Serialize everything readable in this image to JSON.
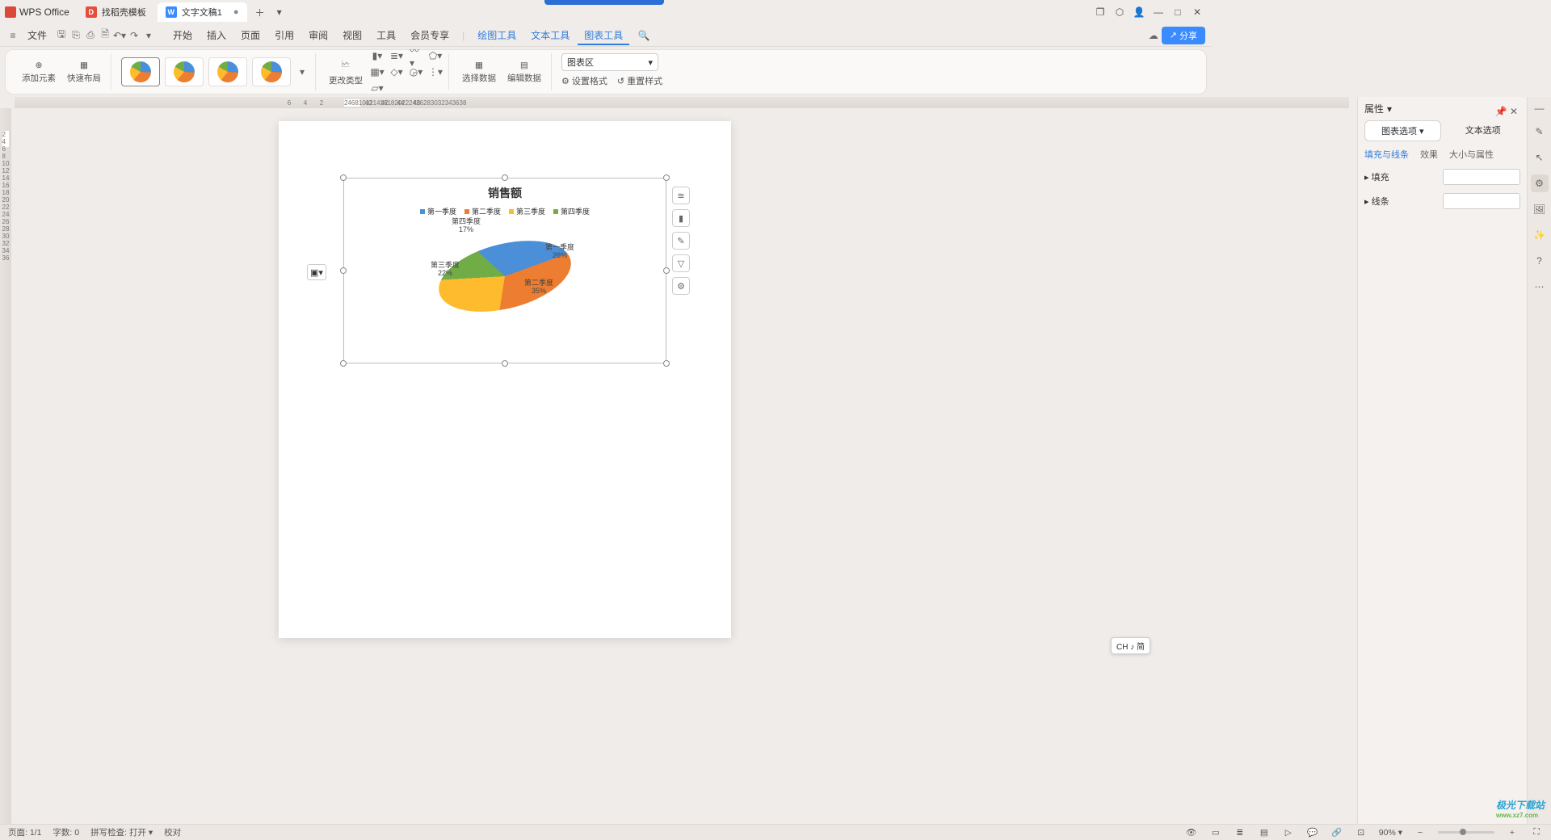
{
  "app": {
    "name": "WPS Office"
  },
  "tabs": [
    {
      "label": "找稻壳模板",
      "iconBg": "#e74c3c",
      "iconTxt": "D"
    },
    {
      "label": "文字文稿1",
      "iconBg": "#3a8bff",
      "iconTxt": "W",
      "active": true
    }
  ],
  "window_buttons": {
    "multiwin": "❐",
    "cube": "⬡",
    "user": "👤",
    "min": "—",
    "max": "□",
    "close": "✕"
  },
  "menubar": {
    "file": "文件",
    "items": [
      "开始",
      "插入",
      "页面",
      "引用",
      "审阅",
      "视图",
      "工具",
      "会员专享"
    ],
    "extra": [
      "绘图工具",
      "文本工具",
      "图表工具"
    ],
    "share": "分享"
  },
  "ribbon": {
    "addElement": "添加元素",
    "quickLayout": "快速布局",
    "changeType": "更改类型",
    "selectData": "选择数据",
    "editData": "编辑数据",
    "chartAreaSel": "图表区",
    "setFormat": "设置格式",
    "resetStyle": "重置样式"
  },
  "chart_data": {
    "type": "pie",
    "title": "销售额",
    "categories": [
      "第一季度",
      "第二季度",
      "第三季度",
      "第四季度"
    ],
    "values": [
      26,
      35,
      22,
      17
    ],
    "series": [
      {
        "name": "销售额",
        "values": [
          26,
          35,
          22,
          17
        ]
      }
    ],
    "labels": [
      {
        "name": "第一季度",
        "pct": "26%"
      },
      {
        "name": "第二季度",
        "pct": "35%"
      },
      {
        "name": "第三季度",
        "pct": "22%"
      },
      {
        "name": "第四季度",
        "pct": "17%"
      }
    ],
    "colors": [
      "#4a8fd8",
      "#ed7d31",
      "#fdbb2d",
      "#70ad47"
    ]
  },
  "rightpane": {
    "title": "属性",
    "tab_chart": "图表选项",
    "tab_text": "文本选项",
    "sub_fill": "填充与线条",
    "sub_effect": "效果",
    "sub_size": "大小与属性",
    "row_fill": "填充",
    "row_line": "线条",
    "pin": "📌",
    "close": "✕",
    "collapse": "—"
  },
  "ime": "CH ♪ 简",
  "hruler_left": [
    "6",
    "4",
    "2"
  ],
  "hruler_doc": [
    "2",
    "4",
    "6",
    "8",
    "10",
    "12",
    "14",
    "16",
    "18",
    "20",
    "22",
    "24",
    "26",
    "28",
    "30",
    "32",
    "34",
    "36",
    "38",
    "40",
    "42",
    "44",
    "46"
  ],
  "vruler_doc": [
    "2",
    "4",
    "6",
    "8",
    "10",
    "12",
    "14",
    "16",
    "18",
    "20",
    "22",
    "24",
    "26",
    "28",
    "30",
    "32",
    "34",
    "36"
  ],
  "status": {
    "page": "页面: 1/1",
    "words": "字数: 0",
    "spell": "拼写检查: 打开",
    "proof": "校对",
    "zoom": "90%"
  },
  "watermark": {
    "line1": "极光下载站",
    "line2": "www.xz7.com"
  }
}
